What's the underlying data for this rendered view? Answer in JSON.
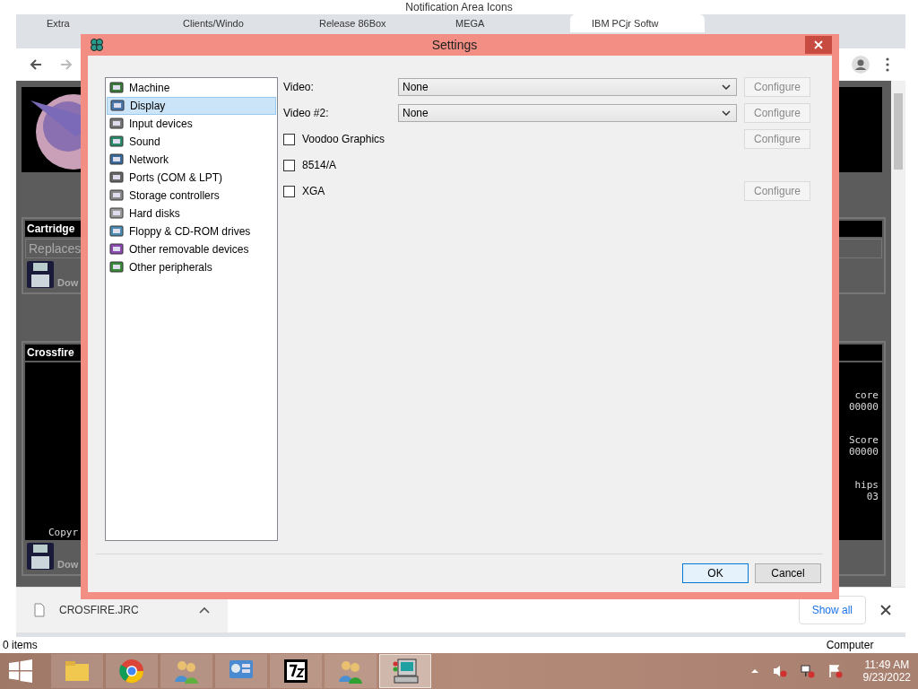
{
  "background_window": {
    "title": "Notification Area Icons",
    "status": "0 items",
    "location": "Computer"
  },
  "browser": {
    "tabs": [
      {
        "title": "Extra",
        "selected": false
      },
      {
        "title": "Clients/Windo",
        "selected": false
      },
      {
        "title": "Release 86Box",
        "selected": false
      },
      {
        "title": "MEGA",
        "selected": false
      },
      {
        "title": "IBM PCjr Softw",
        "selected": true
      }
    ],
    "page": {
      "cartridge": {
        "heading": "Cartridge",
        "subheading": "Replaces",
        "download": "Dow"
      },
      "game": {
        "heading": "Crossfire",
        "screen_texts": [
          "core",
          "00000",
          "Score",
          "00000",
          "hips",
          "03"
        ],
        "footer": "Copyr",
        "download": "Dow"
      }
    },
    "downloads": {
      "file": "CROSFIRE.JRC",
      "show_all": "Show all"
    }
  },
  "dialog": {
    "title": "Settings",
    "categories": [
      {
        "label": "Machine",
        "selected": false
      },
      {
        "label": "Display",
        "selected": true
      },
      {
        "label": "Input devices",
        "selected": false
      },
      {
        "label": "Sound",
        "selected": false
      },
      {
        "label": "Network",
        "selected": false
      },
      {
        "label": "Ports (COM & LPT)",
        "selected": false
      },
      {
        "label": "Storage controllers",
        "selected": false
      },
      {
        "label": "Hard disks",
        "selected": false
      },
      {
        "label": "Floppy & CD-ROM drives",
        "selected": false
      },
      {
        "label": "Other removable devices",
        "selected": false
      },
      {
        "label": "Other peripherals",
        "selected": false
      }
    ],
    "rows": [
      {
        "kind": "select",
        "label": "Video:",
        "value": "None",
        "configure": "Configure",
        "configure_disabled": true
      },
      {
        "kind": "select",
        "label": "Video #2:",
        "value": "None",
        "configure": "Configure",
        "configure_disabled": true
      },
      {
        "kind": "checkbox",
        "label": "Voodoo Graphics",
        "checked": false,
        "configure": "Configure",
        "configure_disabled": true
      },
      {
        "kind": "checkbox",
        "label": "8514/A",
        "checked": false
      },
      {
        "kind": "checkbox",
        "label": "XGA",
        "checked": false,
        "configure": "Configure",
        "configure_disabled": true
      }
    ],
    "buttons": [
      {
        "label": "OK",
        "default": true
      },
      {
        "label": "Cancel",
        "default": false
      }
    ]
  },
  "taskbar": {
    "apps": [
      {
        "selected": false
      },
      {
        "selected": false
      },
      {
        "selected": false
      },
      {
        "selected": false
      },
      {
        "selected": false
      },
      {
        "selected": false
      },
      {
        "selected": true
      }
    ],
    "time": "11:49 AM",
    "date": "9/23/2022"
  }
}
